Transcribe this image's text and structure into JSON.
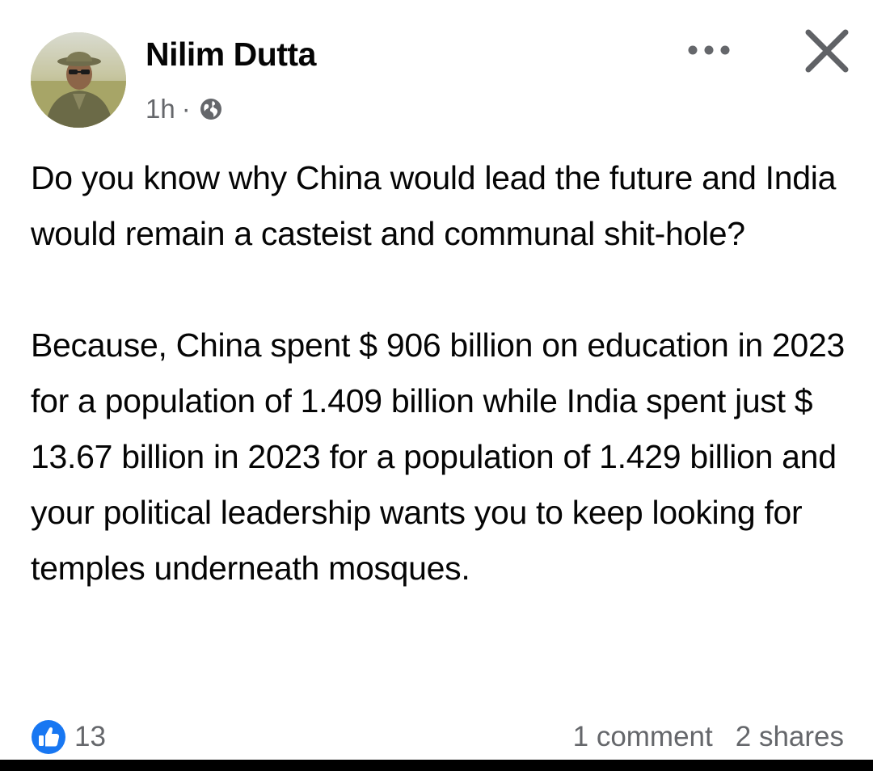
{
  "post": {
    "author_name": "Nilim Dutta",
    "timestamp": "1h",
    "separator": "·",
    "audience_icon": "globe-icon",
    "more_icon": "more-options-icon",
    "close_icon": "close-icon",
    "paragraphs": [
      "Do you know why China would lead the future and India would remain a casteist and communal shit-hole?",
      "Because, China spent $ 906 billion on education in 2023 for a population of 1.409 billion while India spent just $ 13.67 billion in 2023 for a population of 1.429 billion and your political leadership wants you to keep looking for temples underneath mosques."
    ]
  },
  "footer": {
    "reaction_icon": "like-icon",
    "reaction_count": "13",
    "comments_label": "1 comment",
    "shares_label": "2 shares"
  },
  "colors": {
    "text": "#050505",
    "secondary_text": "#65676b",
    "like_blue": "#1877f2"
  }
}
